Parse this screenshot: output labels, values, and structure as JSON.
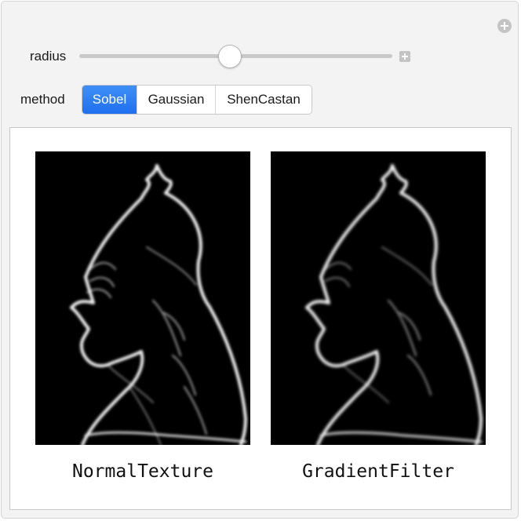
{
  "controls": {
    "radius": {
      "label": "radius",
      "value_fraction": 0.48
    },
    "method": {
      "label": "method",
      "options": [
        "Sobel",
        "Gaussian",
        "ShenCastan"
      ],
      "selected": "Sobel"
    }
  },
  "output": {
    "images": [
      {
        "caption": "NormalTexture"
      },
      {
        "caption": "GradientFilter"
      }
    ]
  },
  "colors": {
    "accent": "#1f6ff0",
    "image_background": "#000000",
    "edge": "#f2f2f2"
  },
  "icons": [
    "plus-circle-icon",
    "plus-square-icon"
  ]
}
